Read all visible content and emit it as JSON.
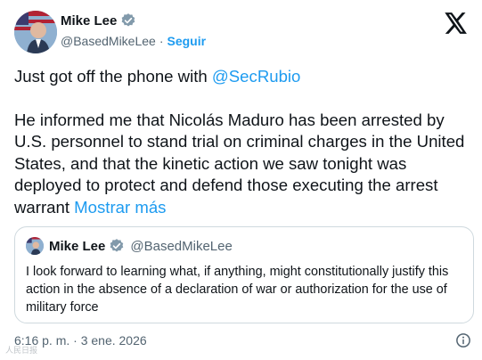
{
  "author": {
    "name": "Mike Lee",
    "handle": "@BasedMikeLee",
    "separator": "·",
    "follow_label": "Seguir"
  },
  "tweet": {
    "line1_text": "Just got off the phone with ",
    "line1_mention": "@SecRubio",
    "body": "He informed me that Nicolás Maduro has been arrested by U.S. personnel to stand trial on criminal charges in the United States, and that the kinetic action we saw tonight was deployed to protect and defend those executing the arrest warrant ",
    "show_more": "Mostrar más"
  },
  "quote": {
    "name": "Mike Lee",
    "handle": "@BasedMikeLee",
    "text": "I look forward to learning what, if anything, might constitutionally justify this action in the absence of a declaration of war or authorization for the use of military force"
  },
  "meta": {
    "timestamp": "6:16 p. m. · 3 ene. 2026"
  },
  "watermark": "人民日报",
  "icons": {
    "verified": "verified-badge-icon",
    "x_logo": "x-logo-icon",
    "info": "info-icon"
  },
  "colors": {
    "link": "#1d9bf0",
    "secondary_text": "#536471",
    "border": "#cfd9de"
  }
}
